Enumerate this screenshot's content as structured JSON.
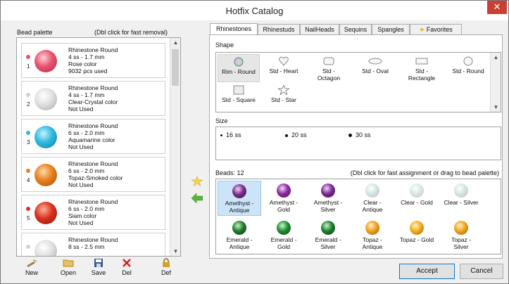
{
  "window": {
    "title": "Hotfix Catalog",
    "close_glyph": "✕"
  },
  "palette": {
    "header_left": "Bead palette",
    "header_right": "(Dbl click for fast removal)",
    "items": [
      {
        "num": "1",
        "line1": "Rhinestone Round",
        "line2": "4 ss -  1.7 mm",
        "line3": "Rose color",
        "line4": "9032 pcs used",
        "color": "#e8536f"
      },
      {
        "num": "2",
        "line1": "Rhinestone Round",
        "line2": "4 ss -  1.7 mm",
        "line3": "Clear-Crystal color",
        "line4": "Not Used",
        "color": "#d9d9d9"
      },
      {
        "num": "3",
        "line1": "Rhinestone Round",
        "line2": "6 ss -  2.0 mm",
        "line3": "Aquamarine color",
        "line4": "Not Used",
        "color": "#2fb8e0"
      },
      {
        "num": "4",
        "line1": "Rhinestone Round",
        "line2": "6 ss -  2.0 mm",
        "line3": "Topaz-Smoked color",
        "line4": "Not Used",
        "color": "#e8801e"
      },
      {
        "num": "5",
        "line1": "Rhinestone Round",
        "line2": "6 ss -  2.0 mm",
        "line3": "Siam color",
        "line4": "Not Used",
        "color": "#d8321e"
      },
      {
        "num": "",
        "line1": "Rhinestone Round",
        "line2": "8 ss -  2.5 mm",
        "line3": "",
        "line4": "",
        "color": "#d9d9d9"
      }
    ]
  },
  "toolbar": {
    "new_label": "New",
    "open_label": "Open",
    "save_label": "Save",
    "del_label": "Del",
    "def_label": "Def"
  },
  "tabs": [
    "Rhinestones",
    "Rhinestuds",
    "NailHeads",
    "Sequins",
    "Spangles",
    "Favorites"
  ],
  "shape": {
    "label": "Shape",
    "items": [
      {
        "l1": "Rim - Round",
        "l2": ""
      },
      {
        "l1": "Std - Heart",
        "l2": ""
      },
      {
        "l1": "Std -",
        "l2": "Octagon"
      },
      {
        "l1": "Std - Oval",
        "l2": ""
      },
      {
        "l1": "Std -",
        "l2": "Rectangle"
      },
      {
        "l1": "Std - Round",
        "l2": ""
      },
      {
        "l1": "Std - Square",
        "l2": ""
      },
      {
        "l1": "Std - Star",
        "l2": ""
      }
    ]
  },
  "size": {
    "label": "Size",
    "items": [
      "16 ss",
      "20 ss",
      "30 ss"
    ]
  },
  "beads": {
    "label": "Beads: 12",
    "hint": "(Dbl click for fast assignment or drag to bead palette)",
    "items": [
      {
        "l1": "Amethyst -",
        "l2": "Antique",
        "color": "#7b2c8c"
      },
      {
        "l1": "Amethyst -",
        "l2": "Gold",
        "color": "#8d2ca0"
      },
      {
        "l1": "Amethyst -",
        "l2": "Silver",
        "color": "#7e2a92"
      },
      {
        "l1": "Clear -",
        "l2": "Antique",
        "color": "#cfe8e0"
      },
      {
        "l1": "Clear - Gold",
        "l2": "",
        "color": "#d6e9e4"
      },
      {
        "l1": "Clear - Silver",
        "l2": "",
        "color": "#d2e6e0"
      },
      {
        "l1": "Emerald -",
        "l2": "Antique",
        "color": "#1f7a2a"
      },
      {
        "l1": "Emerald -",
        "l2": "Gold",
        "color": "#1d8f2d"
      },
      {
        "l1": "Emerald -",
        "l2": "Silver",
        "color": "#1d7f2c"
      },
      {
        "l1": "Topaz -",
        "l2": "Antique",
        "color": "#f0a020"
      },
      {
        "l1": "Topaz - Gold",
        "l2": "",
        "color": "#f4ad1c"
      },
      {
        "l1": "Topaz -",
        "l2": "Silver",
        "color": "#f0a41e"
      }
    ]
  },
  "buttons": {
    "accept_label": "Accept",
    "cancel_label": "Cancel"
  },
  "colors": {
    "accent": "#0078d7",
    "close_bg": "#c84031",
    "selected_bead": "#cce4f7"
  }
}
